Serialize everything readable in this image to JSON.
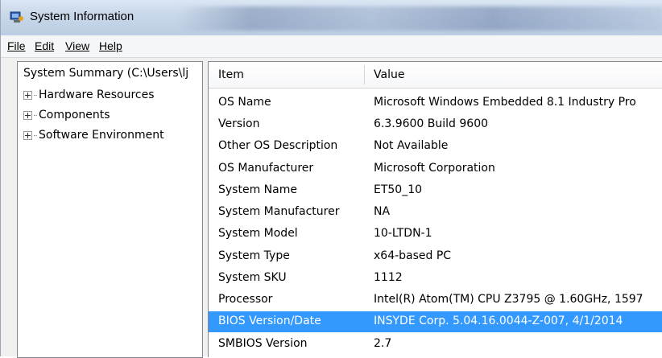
{
  "window": {
    "title": "System Information"
  },
  "menu": {
    "items": [
      {
        "label": "File"
      },
      {
        "label": "Edit"
      },
      {
        "label": "View"
      },
      {
        "label": "Help"
      }
    ]
  },
  "tree": {
    "root": "System Summary (C:\\Users\\lj",
    "nodes": [
      {
        "label": "Hardware Resources"
      },
      {
        "label": "Components"
      },
      {
        "label": "Software Environment"
      }
    ]
  },
  "list": {
    "columns": [
      "Item",
      "Value"
    ],
    "rows": [
      {
        "item": "OS Name",
        "value": "Microsoft Windows Embedded 8.1 Industry Pro"
      },
      {
        "item": "Version",
        "value": "6.3.9600 Build 9600"
      },
      {
        "item": "Other OS Description",
        "value": "Not Available"
      },
      {
        "item": "OS Manufacturer",
        "value": "Microsoft Corporation"
      },
      {
        "item": "System Name",
        "value": "ET50_10"
      },
      {
        "item": "System Manufacturer",
        "value": "NA"
      },
      {
        "item": "System Model",
        "value": "10-LTDN-1"
      },
      {
        "item": "System Type",
        "value": "x64-based PC"
      },
      {
        "item": "System SKU",
        "value": "1112"
      },
      {
        "item": "Processor",
        "value": "Intel(R) Atom(TM) CPU  Z3795  @ 1.60GHz, 1597"
      },
      {
        "item": "BIOS Version/Date",
        "value": "INSYDE Corp. 5.04.16.0044-Z-007, 4/1/2014"
      },
      {
        "item": "SMBIOS Version",
        "value": "2.7"
      }
    ],
    "selected_row_index": 10
  },
  "colors": {
    "selection": "#3399ff",
    "titlebar": "#c9d8ea"
  }
}
